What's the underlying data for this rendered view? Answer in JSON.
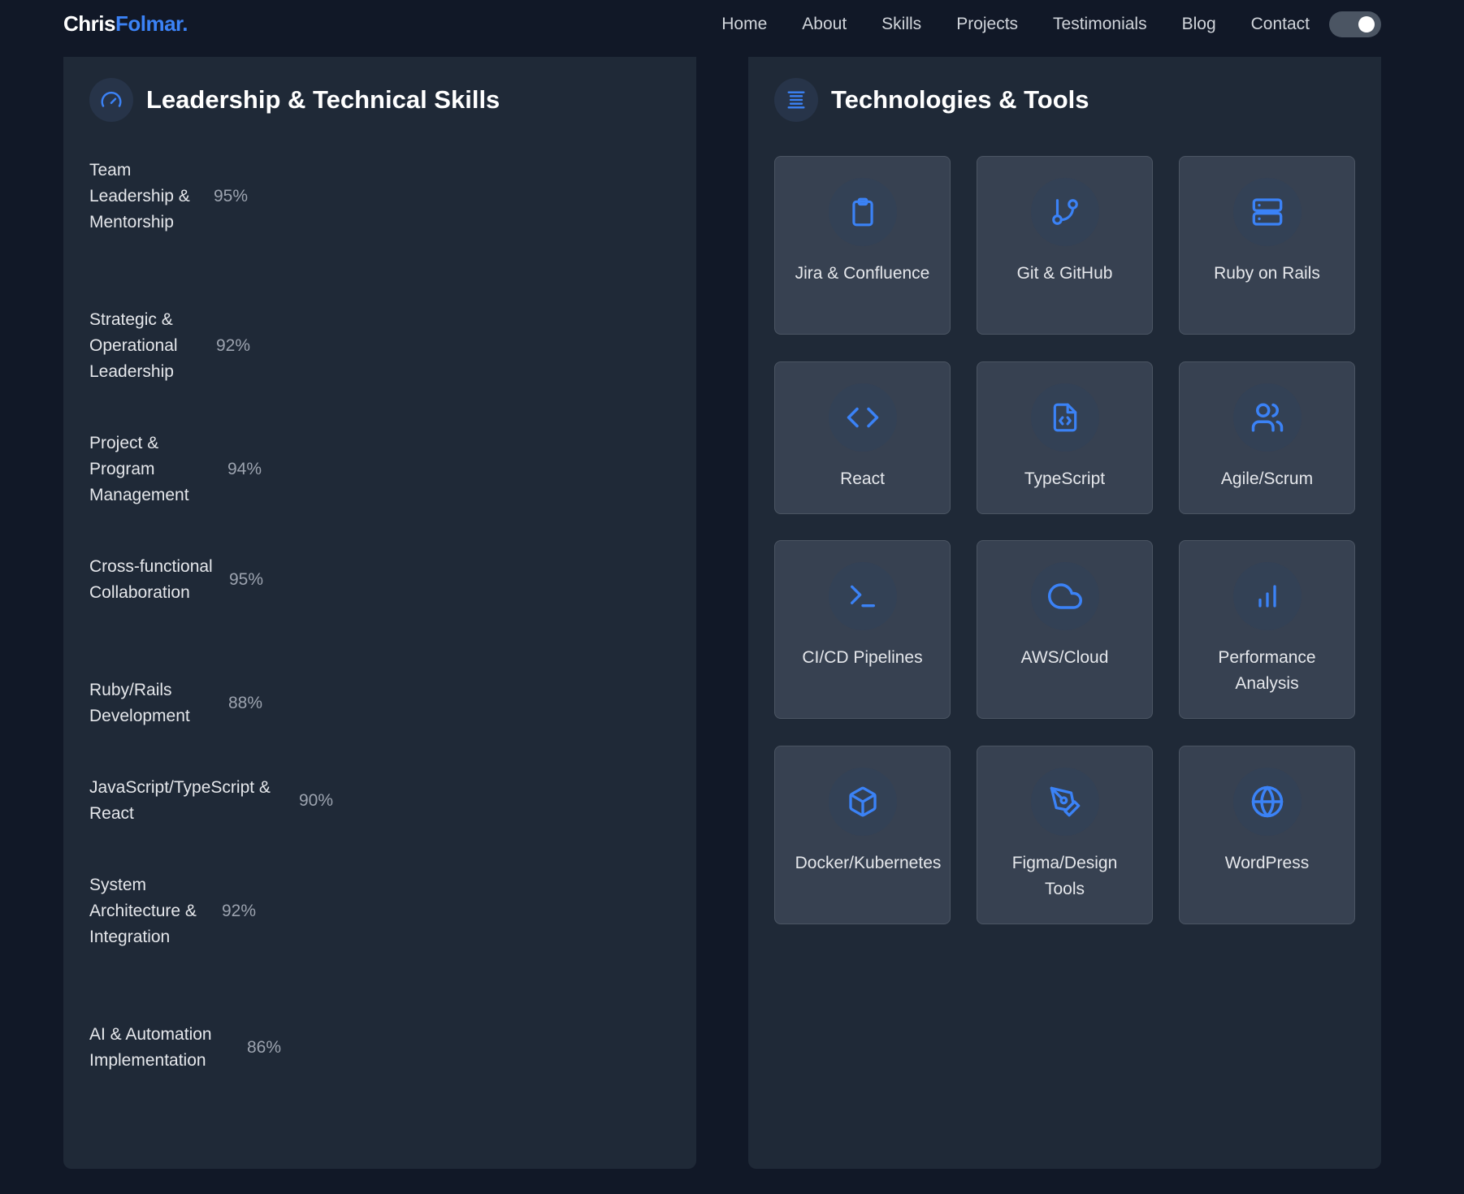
{
  "nav": {
    "logo_first": "Chris",
    "logo_last": "Folmar.",
    "links": [
      "Home",
      "About",
      "Skills",
      "Projects",
      "Testimonials",
      "Blog",
      "Contact"
    ],
    "theme_toggle": "on"
  },
  "skills_panel": {
    "title": "Leadership & Technical Skills",
    "icon": "gauge-icon",
    "skills": [
      {
        "label": "Team Leadership & Mentorship",
        "percent": "95%"
      },
      {
        "label": "Strategic & Operational Leadership",
        "percent": "92%"
      },
      {
        "label": "Project & Program Management",
        "percent": "94%"
      },
      {
        "label": "Cross-functional Collaboration",
        "percent": "95%"
      },
      {
        "label": "Ruby/Rails Development",
        "percent": "88%"
      },
      {
        "label": "JavaScript/TypeScript & React",
        "percent": "90%"
      },
      {
        "label": "System Architecture & Integration",
        "percent": "92%"
      },
      {
        "label": "AI & Automation Implementation",
        "percent": "86%"
      }
    ]
  },
  "tools_panel": {
    "title": "Technologies & Tools",
    "icon": "list-icon",
    "tools": [
      {
        "label": "Jira & Confluence",
        "icon": "clipboard-icon"
      },
      {
        "label": "Git & GitHub",
        "icon": "git-branch-icon"
      },
      {
        "label": "Ruby on Rails",
        "icon": "server-icon"
      },
      {
        "label": "React",
        "icon": "code-icon"
      },
      {
        "label": "TypeScript",
        "icon": "file-code-icon"
      },
      {
        "label": "Agile/Scrum",
        "icon": "users-icon"
      },
      {
        "label": "CI/CD Pipelines",
        "icon": "terminal-icon"
      },
      {
        "label": "AWS/Cloud",
        "icon": "cloud-icon"
      },
      {
        "label": "Performance Analysis",
        "icon": "bar-chart-icon"
      },
      {
        "label": "Docker/Kubernetes",
        "icon": "box-icon"
      },
      {
        "label": "Figma/Design Tools",
        "icon": "pen-tool-icon"
      },
      {
        "label": "WordPress",
        "icon": "globe-icon"
      }
    ]
  },
  "colors": {
    "accent": "#3b82f6",
    "page_bg": "#111827",
    "panel_bg": "#1f2937",
    "card_bg": "#374151"
  }
}
